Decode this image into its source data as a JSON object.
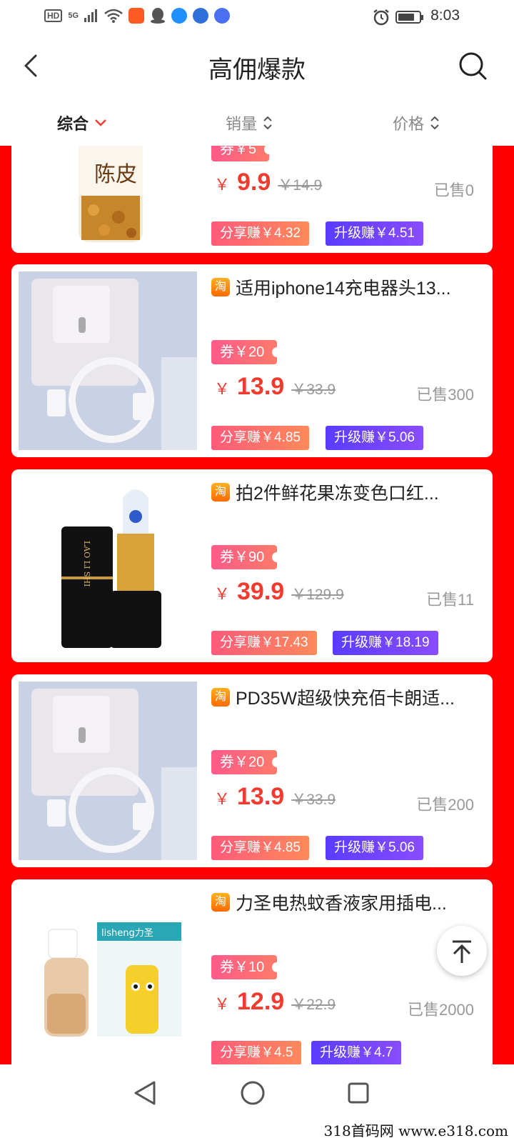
{
  "status_bar": {
    "network_badge": "HD",
    "network_type": "5G",
    "time": "8:03",
    "icons": [
      "wifi-icon",
      "taobao-icon",
      "qq-icon",
      "cloud-icon",
      "browser-icon",
      "music-icon",
      "alarm-icon",
      "battery-icon"
    ]
  },
  "header": {
    "title": "高佣爆款",
    "back_icon": "chevron-left-icon",
    "search_icon": "search-icon"
  },
  "sort_tabs": [
    {
      "label": "综合",
      "active": true
    },
    {
      "label": "销量",
      "active": false
    },
    {
      "label": "价格",
      "active": false
    }
  ],
  "products": [
    {
      "title": "",
      "coupon": "券￥5",
      "yen": "￥",
      "price": "9.9",
      "original_price": "￥14.9",
      "sold": "已售0",
      "share_earn": "分享赚￥4.32",
      "upgrade_earn": "升级赚￥4.51",
      "image_text": "陈皮"
    },
    {
      "title": "适用iphone14充电器头13...",
      "coupon": "券￥20",
      "yen": "￥",
      "price": "13.9",
      "original_price": "￥33.9",
      "sold": "已售300",
      "share_earn": "分享赚￥4.85",
      "upgrade_earn": "升级赚￥5.06"
    },
    {
      "title": "拍2件鲜花果冻变色口红...",
      "coupon": "券￥90",
      "yen": "￥",
      "price": "39.9",
      "original_price": "￥129.9",
      "sold": "已售11",
      "share_earn": "分享赚￥17.43",
      "upgrade_earn": "升级赚￥18.19",
      "image_text": "LAO LI SHI"
    },
    {
      "title": "PD35W超级快充佰卡朗适...",
      "coupon": "券￥20",
      "yen": "￥",
      "price": "13.9",
      "original_price": "￥33.9",
      "sold": "已售200",
      "share_earn": "分享赚￥4.85",
      "upgrade_earn": "升级赚￥5.06"
    },
    {
      "title": "力圣电热蚊香液家用插电...",
      "coupon": "券￥10",
      "yen": "￥",
      "price": "12.9",
      "original_price": "￥22.9",
      "sold": "已售2000",
      "share_earn": "分享赚￥4.5",
      "upgrade_earn": "升级赚￥4.7",
      "image_text": "lisheng力圣"
    }
  ],
  "taobao_badge": "淘",
  "watermark": "318首码网 www.e318.com",
  "colors": {
    "list_background": "#ff0000",
    "price": "#f23b2f",
    "share_button": "#ff6a6a",
    "upgrade_button": "#6a40ff"
  }
}
